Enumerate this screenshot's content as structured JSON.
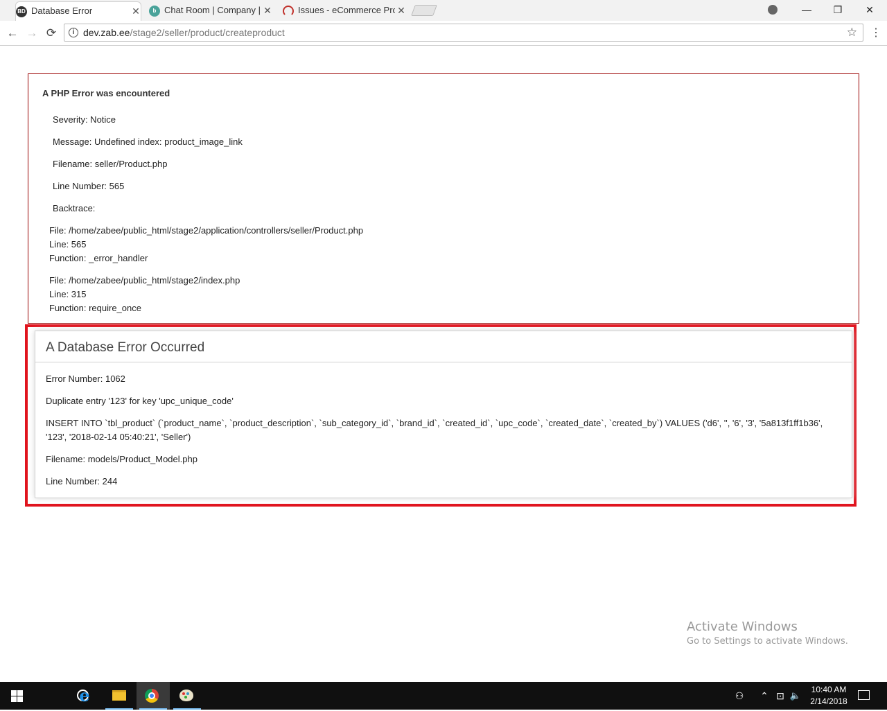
{
  "browser": {
    "tabs": [
      {
        "title": "Database Error",
        "favicon": "BD",
        "active": true
      },
      {
        "title": "Chat Room | Company | B",
        "favicon": "b",
        "active": false
      },
      {
        "title": "Issues - eCommerce Proj",
        "favicon": "redmine",
        "active": false
      }
    ],
    "close_glyph": "✕",
    "url_host": "dev.zab.ee",
    "url_path": "/stage2/seller/product/createproduct",
    "icons": {
      "back": "←",
      "forward": "→",
      "reload": "⟳",
      "info": "i",
      "star": "☆",
      "menu": "⋮",
      "minimize": "—",
      "restore": "❐",
      "close": "✕"
    }
  },
  "php_error": {
    "heading": "A PHP Error was encountered",
    "severity": "Severity: Notice",
    "message": "Message: Undefined index: product_image_link",
    "filename": "Filename: seller/Product.php",
    "line_number": "Line Number: 565",
    "backtrace_label": "Backtrace:",
    "trace": [
      {
        "file": "File: /home/zabee/public_html/stage2/application/controllers/seller/Product.php",
        "line": "Line: 565",
        "function": "Function: _error_handler"
      },
      {
        "file": "File: /home/zabee/public_html/stage2/index.php",
        "line": "Line: 315",
        "function": "Function: require_once"
      }
    ]
  },
  "db_error": {
    "heading": "A Database Error Occurred",
    "error_number": "Error Number: 1062",
    "message": "Duplicate entry '123' for key 'upc_unique_code'",
    "query": "INSERT INTO `tbl_product` (`product_name`, `product_description`, `sub_category_id`, `brand_id`, `created_id`, `upc_code`, `created_date`, `created_by`) VALUES ('d6', '', '6', '3', '5a813f1ff1b36', '123', '2018-02-14 05:40:21', 'Seller')",
    "filename": "Filename: models/Product_Model.php",
    "line_number": "Line Number: 244",
    "highlight_color": "#e0141e"
  },
  "watermark": {
    "line1": "Activate Windows",
    "line2": "Go to Settings to activate Windows."
  },
  "taskbar": {
    "time": "10:40 AM",
    "date": "2/14/2018",
    "icons": {
      "people": "⚇",
      "chevron": "⌃",
      "network": "⊡",
      "volume": "🔈"
    }
  }
}
